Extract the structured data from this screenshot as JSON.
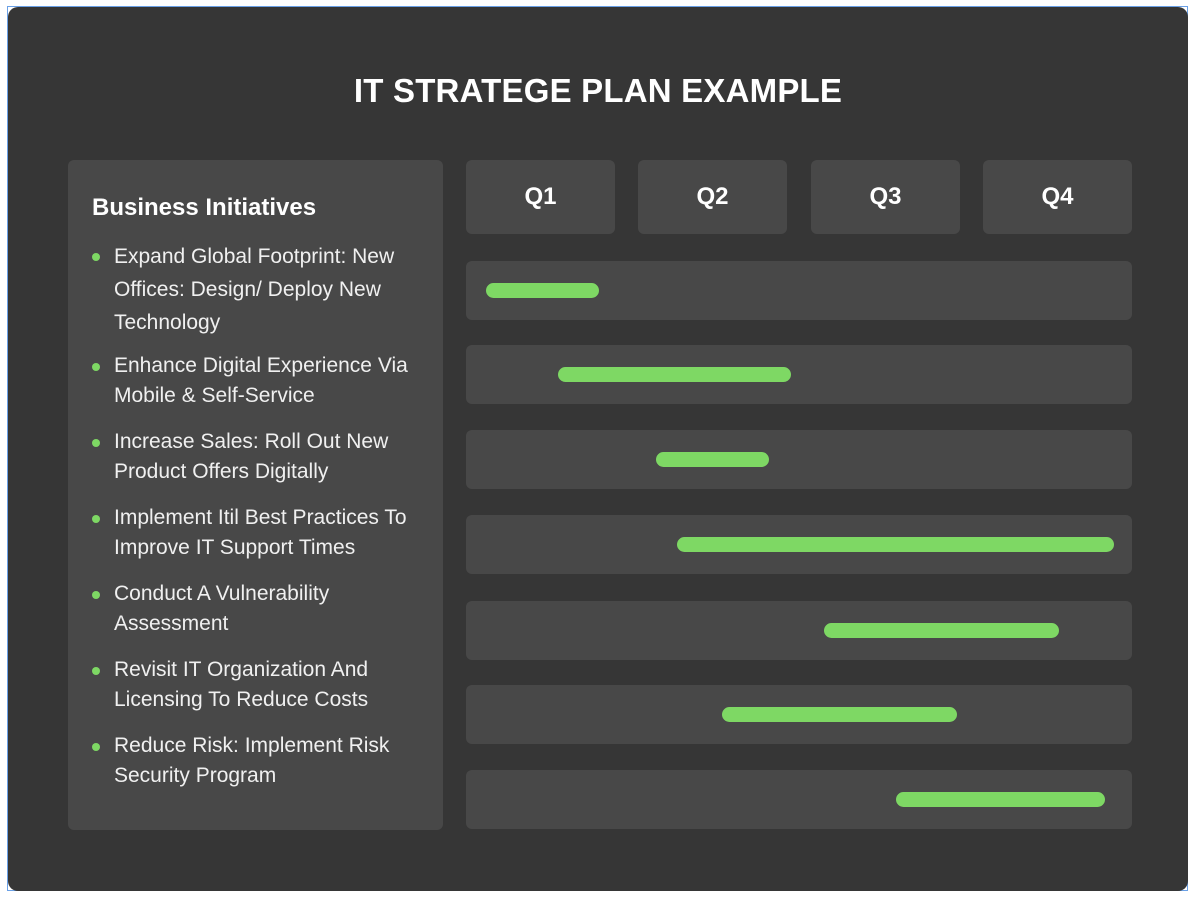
{
  "title": "IT STRATEGE PLAN EXAMPLE",
  "colors": {
    "background": "#363636",
    "card": "#484848",
    "accent_green": "#7ed864",
    "text": "#ffffff",
    "frame_border": "#6aa0e6"
  },
  "left_panel": {
    "heading": "Business Initiatives",
    "items": [
      {
        "label": "Expand Global Footprint: New Offices: Design/ Deploy New Technology",
        "icon": "bullet-dot"
      },
      {
        "label": "Enhance Digital Experience Via Mobile & Self-Service",
        "icon": "bullet-dot"
      },
      {
        "label": "Increase Sales: Roll Out New Product Offers Digitally",
        "icon": "bullet-dot"
      },
      {
        "label": "Implement Itil Best Practices To Improve IT Support Times",
        "icon": "bullet-dot"
      },
      {
        "label": "Conduct A Vulnerability Assessment",
        "icon": "bullet-dot"
      },
      {
        "label": "Revisit IT Organization And Licensing To Reduce Costs",
        "icon": "bullet-dot"
      },
      {
        "label": "Reduce Risk: Implement Risk Security Program",
        "icon": "bullet-dot"
      }
    ]
  },
  "chart_data": {
    "type": "gantt",
    "title": "IT STRATEGE PLAN EXAMPLE",
    "categories": [
      "Q1",
      "Q2",
      "Q3",
      "Q4"
    ],
    "x_unit": "quarters elapsed (0 = start of Q1, 4 = end of Q4)",
    "xlim": [
      0,
      4
    ],
    "tasks": [
      {
        "name": "Expand Global Footprint: New Offices: Design/ Deploy New Technology",
        "start": 0.12,
        "end": 0.8
      },
      {
        "name": "Enhance Digital Experience Via Mobile & Self-Service",
        "start": 0.55,
        "end": 1.95
      },
      {
        "name": "Increase Sales: Roll Out New Product Offers Digitally",
        "start": 1.14,
        "end": 1.82
      },
      {
        "name": "Implement Itil Best Practices To Improve IT Support Times",
        "start": 1.27,
        "end": 3.89
      },
      {
        "name": "Conduct A Vulnerability Assessment",
        "start": 2.15,
        "end": 3.56
      },
      {
        "name": "Revisit IT Organization And Licensing To Reduce Costs",
        "start": 1.54,
        "end": 2.95
      },
      {
        "name": "Reduce Risk: Implement Risk Security Program",
        "start": 2.58,
        "end": 3.84
      }
    ],
    "grid": false,
    "legend": "none"
  }
}
